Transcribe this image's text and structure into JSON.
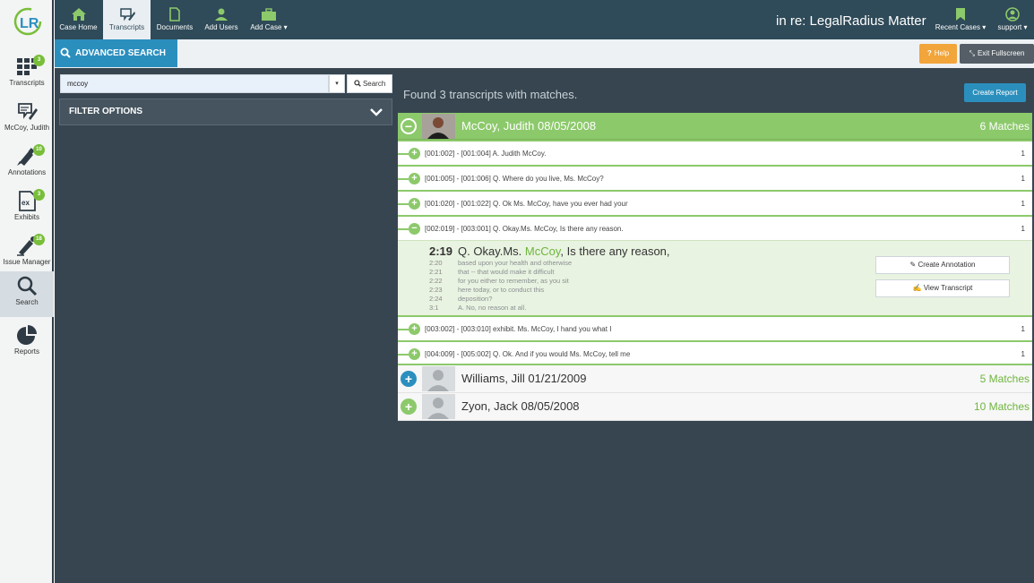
{
  "sidebar": {
    "items": [
      {
        "label": "Transcripts",
        "badge": "3",
        "icon": "grid-icon"
      },
      {
        "label": "McCoy, Judith",
        "badge": "",
        "icon": "transcript-pen-icon"
      },
      {
        "label": "Annotations",
        "badge": "10",
        "icon": "highlighter-icon"
      },
      {
        "label": "Exhibits",
        "badge": "3",
        "icon": "exhibit-icon"
      },
      {
        "label": "Issue Manager",
        "badge": "18",
        "icon": "issue-marker-icon"
      },
      {
        "label": "Search",
        "badge": "",
        "icon": "search-icon"
      },
      {
        "label": "Reports",
        "badge": "",
        "icon": "pie-chart-icon"
      }
    ]
  },
  "nav": {
    "items": [
      {
        "label": "Case Home",
        "icon": "home-icon"
      },
      {
        "label": "Transcripts",
        "icon": "transcript-icon"
      },
      {
        "label": "Documents",
        "icon": "document-icon"
      },
      {
        "label": "Add Users",
        "icon": "add-user-icon"
      },
      {
        "label": "Add Case ▾",
        "icon": "briefcase-icon"
      }
    ],
    "case_title": "in re: LegalRadius Matter",
    "recent_cases": "Recent Cases ▾",
    "user": "support ▾"
  },
  "subbar": {
    "tab_label": "ADVANCED SEARCH",
    "help_label": "Help",
    "exit_label": "Exit Fullscreen"
  },
  "search": {
    "value": "mccoy",
    "button_label": "Search",
    "filter_label": "FILTER OPTIONS"
  },
  "results": {
    "summary": "Found 3 transcripts with matches.",
    "create_report": "Create Report",
    "groups": [
      {
        "name": "McCoy, Judith 08/05/2008",
        "count": "6 Matches",
        "matches": [
          {
            "text": "[001:002] - [001:004] A. Judith McCoy.",
            "count": "1"
          },
          {
            "text": "[001:005] - [001:006] Q. Where do you live, Ms. McCoy?",
            "count": "1"
          },
          {
            "text": "[001:020] - [001:022] Q. Ok Ms. McCoy, have you ever had your",
            "count": "1"
          },
          {
            "text": "[002:019] - [003:001] Q. Okay.Ms. McCoy, Is there any reason.",
            "count": "1"
          },
          {
            "text": "[003:002] - [003:010] exhibit. Ms. McCoy, I hand you what I",
            "count": "1"
          },
          {
            "text": "[004:009] - [005:002] Q. Ok. And if you would Ms. McCoy, tell me",
            "count": "1"
          }
        ],
        "expanded": {
          "line_no": "2:19",
          "prefix": "Q. Okay.Ms.",
          "highlight": "McCoy",
          "suffix": ", Is there any reason,",
          "lines": [
            {
              "no": "2:20",
              "text": "based upon your health and otherwise"
            },
            {
              "no": "2:21",
              "text": "that -- that would make it difficult"
            },
            {
              "no": "2:22",
              "text": "for you either to remember, as you sit"
            },
            {
              "no": "2:23",
              "text": "here today, or to conduct this"
            },
            {
              "no": "2:24",
              "text": "deposition?"
            },
            {
              "no": "3:1",
              "text": "A. No, no reason at all."
            }
          ],
          "create_annotation": "Create Annotation",
          "view_transcript": "View Transcript"
        }
      },
      {
        "name": "Williams, Jill 01/21/2009",
        "count": "5 Matches"
      },
      {
        "name": "Zyon, Jack 08/05/2008",
        "count": "10 Matches"
      }
    ]
  },
  "colors": {
    "nav_bg": "#2f4a58",
    "accent_blue": "#2b8fbe",
    "match_green": "#8cc96b",
    "highlight_green": "#6fb53e",
    "help_orange": "#f2a53a",
    "main_bg": "#374550"
  }
}
